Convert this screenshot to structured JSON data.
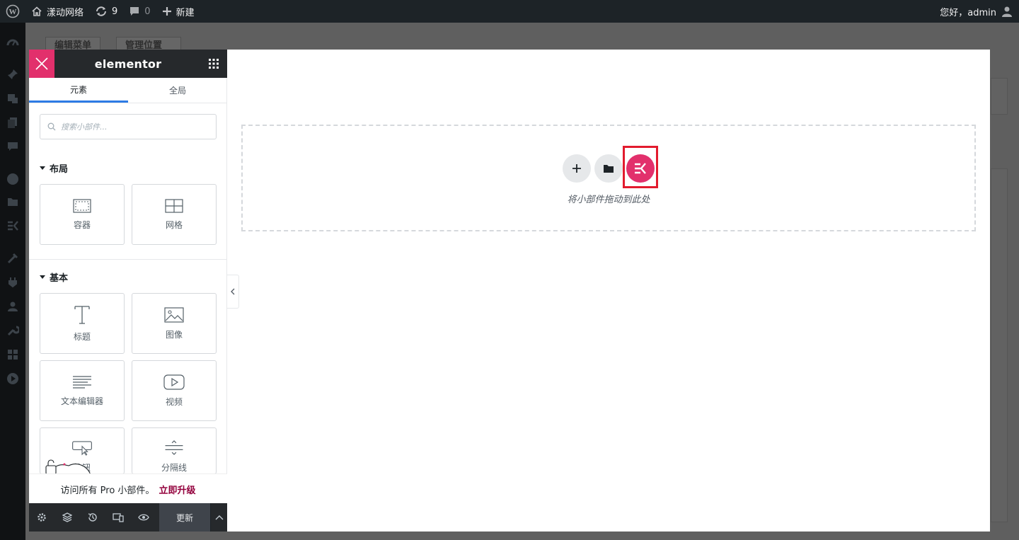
{
  "admin_bar": {
    "site_name": "漾动网络",
    "updates_count": "9",
    "comments_count": "0",
    "new_label": "新建",
    "greeting": "您好，admin"
  },
  "background_page": {
    "tabs": [
      "编辑菜单",
      "管理位置"
    ]
  },
  "panel": {
    "logo": "elementor",
    "tabs": [
      {
        "label": "元素",
        "active": true
      },
      {
        "label": "全局",
        "active": false
      }
    ],
    "search": {
      "placeholder": "搜索小部件..."
    },
    "categories": [
      {
        "title": "布局",
        "widgets": [
          {
            "label": "容器",
            "icon": "container-icon"
          },
          {
            "label": "网格",
            "icon": "grid-icon"
          }
        ]
      },
      {
        "title": "基本",
        "widgets": [
          {
            "label": "标题",
            "icon": "heading-icon"
          },
          {
            "label": "图像",
            "icon": "image-icon"
          },
          {
            "label": "文本编辑器",
            "icon": "text-editor-icon"
          },
          {
            "label": "视频",
            "icon": "video-icon"
          },
          {
            "label": "按钮",
            "icon": "button-icon"
          },
          {
            "label": "分隔线",
            "icon": "divider-icon"
          }
        ]
      }
    ],
    "promo": {
      "text": "访问所有 Pro 小部件。",
      "link": "立即升级"
    },
    "footer": {
      "update_label": "更新"
    }
  },
  "canvas": {
    "drop_hint": "将小部件拖动到此处"
  },
  "colors": {
    "accent": "#e2306c",
    "tab_active": "#2d7be5",
    "highlight_box": "#e21b2e",
    "promo_link": "#93003c"
  }
}
